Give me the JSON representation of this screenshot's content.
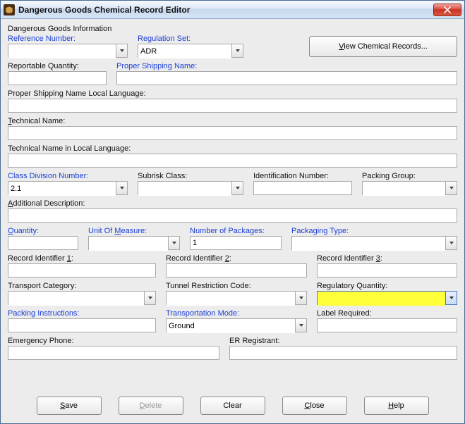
{
  "window": {
    "title": "Dangerous Goods Chemical Record Editor"
  },
  "group": {
    "title": "Dangerous Goods Information"
  },
  "labels": {
    "reference_number": "Reference Number:",
    "regulation_set": "Regulation Set:",
    "view_records": "View Chemical Records...",
    "reportable_qty": "Reportable Quantity:",
    "proper_shipping": "Proper Shipping Name:",
    "psn_local": "Proper Shipping Name Local Language:",
    "technical_name": "Technical Name:",
    "tech_local": "Technical Name in Local Language:",
    "class_div": "Class Division Number:",
    "subrisk": "Subrisk Class:",
    "id_number": "Identification Number:",
    "packing_group": "Packing Group:",
    "add_desc": "Additional Description:",
    "quantity": "Quantity:",
    "uom": "Unit Of Measure:",
    "num_packages": "Number of Packages:",
    "packaging_type": "Packaging Type:",
    "rec_id1": "Record Identifier 1:",
    "rec_id2": "Record Identifier 2:",
    "rec_id3": "Record Identifier 3:",
    "transport_cat": "Transport Category:",
    "tunnel": "Tunnel Restriction Code:",
    "reg_qty": "Regulatory Quantity:",
    "packing_instr": "Packing Instructions:",
    "transport_mode": "Transportation Mode:",
    "label_req": "Label Required:",
    "emergency_phone": "Emergency Phone:",
    "er_reg": "ER Registrant:"
  },
  "values": {
    "reference_number": "",
    "regulation_set": "ADR",
    "reportable_qty": "",
    "proper_shipping": "",
    "psn_local": "",
    "technical_name": "",
    "tech_local": "",
    "class_div": "2.1",
    "subrisk": "",
    "id_number": "",
    "packing_group": "",
    "add_desc": "",
    "quantity": "",
    "uom": "",
    "num_packages": "1",
    "packaging_type": "",
    "rec_id1": "",
    "rec_id2": "",
    "rec_id3": "",
    "transport_cat": "",
    "tunnel": "",
    "reg_qty": "",
    "packing_instr": "",
    "transport_mode": "Ground",
    "label_req": "",
    "emergency_phone": "",
    "er_reg": ""
  },
  "buttons": {
    "save": "Save",
    "delete": "Delete",
    "clear": "Clear",
    "close": "Close",
    "help": "Help"
  }
}
